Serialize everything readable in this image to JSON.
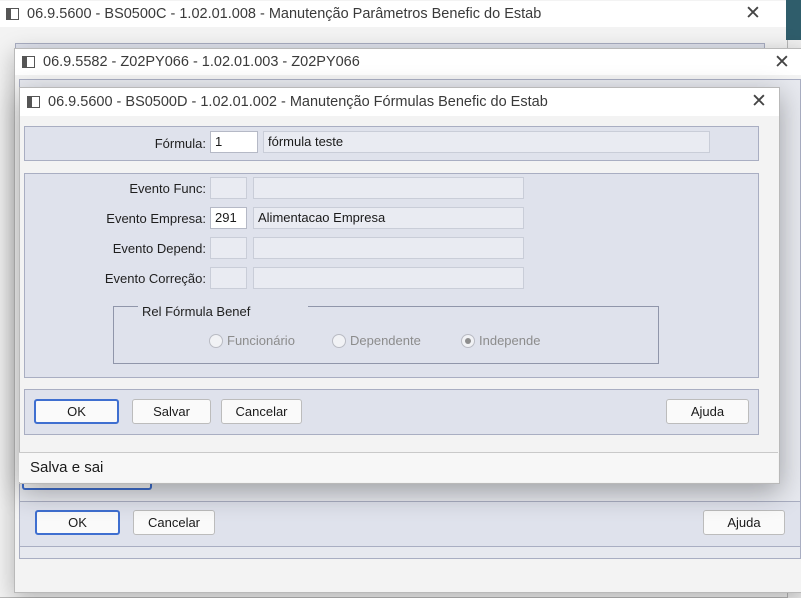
{
  "windows": {
    "back": {
      "title": "06.9.5600 - BS0500C - 1.02.01.008 - Manutenção Parâmetros Benefic do Estab"
    },
    "middle": {
      "title": "06.9.5582 - Z02PY066 - 1.02.01.003 - Z02PY066",
      "buttons": {
        "ok": "OK",
        "cancel": "Cancelar",
        "help": "Ajuda"
      }
    },
    "front": {
      "title": "06.9.5600 - BS0500D - 1.02.01.002 - Manutenção Fórmulas Benefic do Estab",
      "formula": {
        "label": "Fórmula:",
        "value": "1",
        "description": "fórmula teste"
      },
      "events": [
        {
          "label": "Evento Func:",
          "code": "",
          "description": ""
        },
        {
          "label": "Evento Empresa:",
          "code": "291",
          "description": "Alimentacao Empresa"
        },
        {
          "label": "Evento Depend:",
          "code": "",
          "description": ""
        },
        {
          "label": "Evento Correção:",
          "code": "",
          "description": ""
        }
      ],
      "rel_group": {
        "legend": "Rel Fórmula Benef",
        "options": [
          "Funcionário",
          "Dependente",
          "Independe"
        ],
        "selected": "Independe"
      },
      "buttons": {
        "ok": "OK",
        "save": "Salvar",
        "cancel": "Cancelar",
        "help": "Ajuda"
      },
      "status": "Salva e sai"
    }
  },
  "close_glyph": "✕",
  "colors": {
    "panel": "#dfe2ec",
    "focus_border": "#3f6fd0"
  }
}
